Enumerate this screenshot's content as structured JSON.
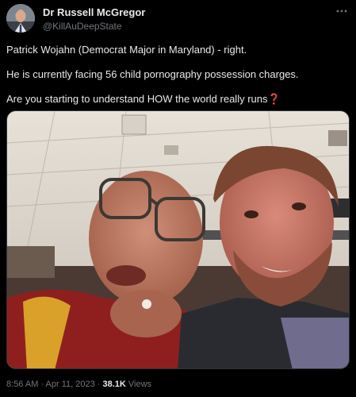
{
  "author": {
    "display_name": "Dr Russell McGregor",
    "handle": "@KillAuDeepState"
  },
  "menu_icon": "more-horizontal-icon",
  "tweet": {
    "line1": "Patrick Wojahn (Democrat Major in Maryland) - right.",
    "line2": "He is currently facing 56 child pornography possession charges.",
    "line3": "Are you starting to understand HOW the world really runs",
    "line3_emoji": "❓"
  },
  "meta": {
    "time": "8:56 AM",
    "sep1": " · ",
    "date": "Apr 11, 2023",
    "sep2": " · ",
    "views_count": "38.1K",
    "views_label": " Views"
  },
  "colors": {
    "background": "#000000",
    "text_primary": "#e7e9ea",
    "text_secondary": "#71767b",
    "emoji_red": "#f4212e"
  }
}
